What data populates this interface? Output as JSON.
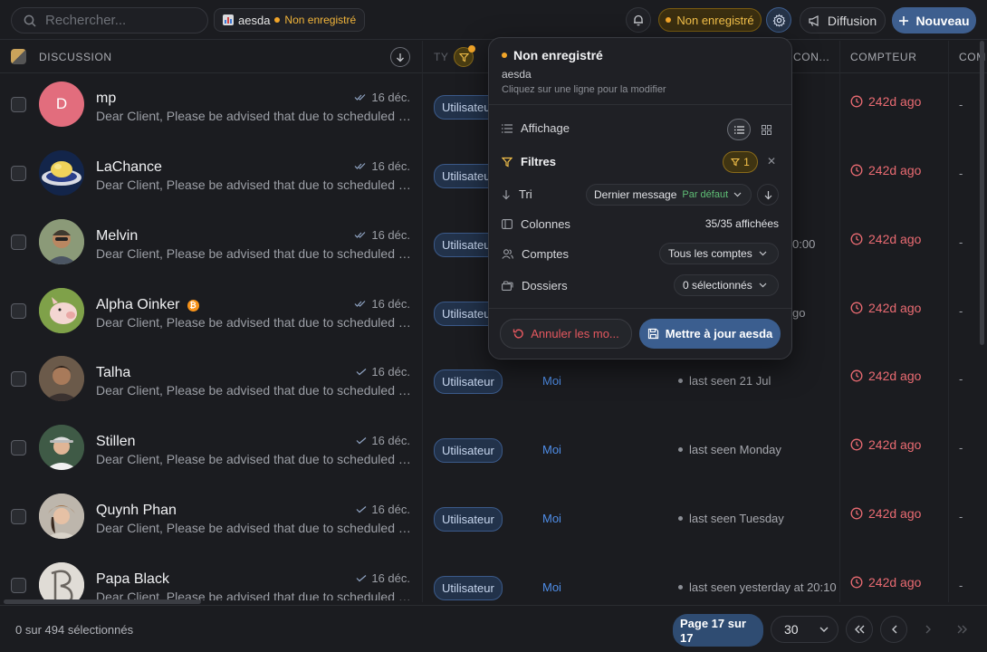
{
  "search": {
    "placeholder": "Rechercher..."
  },
  "view_chip": {
    "name": "aesda",
    "status": "Non enregistré"
  },
  "header": {
    "status_pill": "Non enregistré",
    "diffusion": "Diffusion",
    "new_button": "Nouveau"
  },
  "columns": {
    "discussion": "DISCUSSION",
    "type": "TY",
    "connexion": "CON...",
    "compteur": "COMPTEUR",
    "extra": "COM"
  },
  "rows": [
    {
      "name": "mp",
      "initial": "D",
      "preview": "Dear Client, Please be advised that due to scheduled maintenance",
      "date": "16 déc.",
      "type": "Utilisateur",
      "assigned": "",
      "seen": "",
      "counter": "242d ago",
      "extra": "-"
    },
    {
      "name": "LaChance",
      "preview": "Dear Client, Please be advised that due to scheduled maintenance",
      "date": "16 déc.",
      "type": "Utilisateur",
      "assigned": "",
      "seen": "",
      "counter": "242d ago",
      "extra": "-"
    },
    {
      "name": "Melvin",
      "preview": "Dear Client, Please be advised that due to scheduled maintenance",
      "date": "16 déc.",
      "type": "Utilisateur",
      "assigned": "",
      "seen": "0:00",
      "counter": "242d ago",
      "extra": "-"
    },
    {
      "name": "Alpha Oinker",
      "preview": "Dear Client, Please be advised that due to scheduled maintenance",
      "date": "16 déc.",
      "type": "Utilisateur",
      "assigned": "",
      "seen": "go",
      "counter": "242d ago",
      "extra": "-"
    },
    {
      "name": "Talha",
      "preview": "Dear Client, Please be advised that due to scheduled maintenance",
      "date": "16 déc.",
      "type": "Utilisateur",
      "assigned": "Moi",
      "seen": "last seen 21 Jul",
      "counter": "242d ago",
      "extra": "-"
    },
    {
      "name": "Stillen",
      "preview": "Dear Client, Please be advised that due to scheduled maintenance",
      "date": "16 déc.",
      "type": "Utilisateur",
      "assigned": "Moi",
      "seen": "last seen Monday",
      "counter": "242d ago",
      "extra": "-"
    },
    {
      "name": "Quynh Phan",
      "preview": "Dear Client, Please be advised that due to scheduled maintenance",
      "date": "16 déc.",
      "type": "Utilisateur",
      "assigned": "Moi",
      "seen": "last seen Tuesday",
      "counter": "242d ago",
      "extra": "-"
    },
    {
      "name": "Papa Black",
      "preview": "Dear Client, Please be advised that due to scheduled maintenance",
      "date": "16 déc.",
      "type": "Utilisateur",
      "assigned": "Moi",
      "seen": "last seen yesterday at 20:10",
      "counter": "242d ago",
      "extra": "-"
    }
  ],
  "footer": {
    "selected": "0 sur 494 sélectionnés",
    "page": "Page 17 sur 17",
    "per_page": "30"
  },
  "popover": {
    "title": "Non enregistré",
    "view_name": "aesda",
    "hint": "Cliquez sur une ligne pour la modifier",
    "display_label": "Affichage",
    "filters_label": "Filtres",
    "filters_count": "1",
    "sort_label": "Tri",
    "sort_value": "Dernier message",
    "sort_default": "Par défaut",
    "columns_label": "Colonnes",
    "columns_value": "35/35 affichées",
    "accounts_label": "Comptes",
    "accounts_value": "Tous les comptes",
    "folders_label": "Dossiers",
    "folders_value": "0 sélectionnés",
    "cancel_button": "Annuler les mo...",
    "save_button": "Mettre à jour aesda"
  },
  "colors": {
    "background": "#1b1c20",
    "accent": "#3e5f8f",
    "warning": "#f2a529",
    "danger": "#ea6b72",
    "link": "#4f8ee8"
  }
}
